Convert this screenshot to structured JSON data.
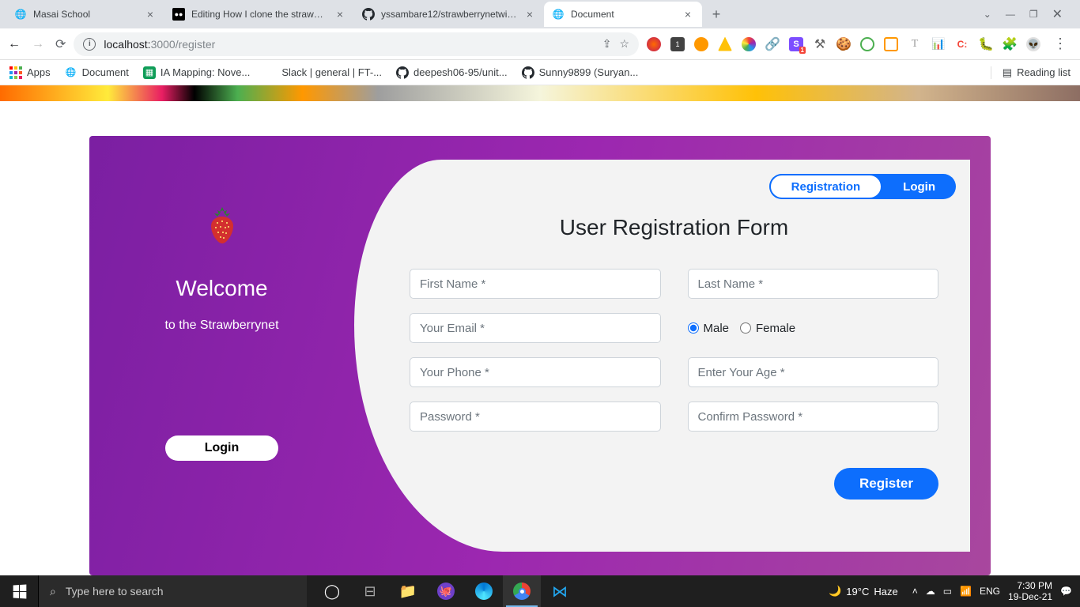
{
  "browser": {
    "tabs": [
      {
        "title": "Masai School"
      },
      {
        "title": "Editing How I clone the strawberr"
      },
      {
        "title": "yssambare12/strawberrynetwithb"
      },
      {
        "title": "Document"
      }
    ],
    "activeTabIndex": 3,
    "url_host": "localhost:",
    "url_port": "3000",
    "url_path": "/register"
  },
  "bookmarks": {
    "apps": "Apps",
    "items": [
      "Document",
      "IA Mapping: Nove...",
      "Slack | general | FT-...",
      "deepesh06-95/unit...",
      "Sunny9899 (Suryan..."
    ],
    "reading": "Reading list"
  },
  "welcome": {
    "title": "Welcome",
    "subtitle": "to the Strawberrynet",
    "login": "Login"
  },
  "tabs": {
    "registration": "Registration",
    "login": "Login"
  },
  "form": {
    "title": "User Registration Form",
    "firstName": "First Name *",
    "lastName": "Last Name *",
    "email": "Your Email *",
    "phone": "Your Phone *",
    "password": "Password *",
    "male": "Male",
    "female": "Female",
    "age": "Enter Your Age *",
    "confirm": "Confirm Password *",
    "register": "Register"
  },
  "taskbar": {
    "search": "Type here to search",
    "weather_temp": "19°C",
    "weather_cond": "Haze",
    "lang": "ENG",
    "time": "7:30 PM",
    "date": "19-Dec-21"
  }
}
